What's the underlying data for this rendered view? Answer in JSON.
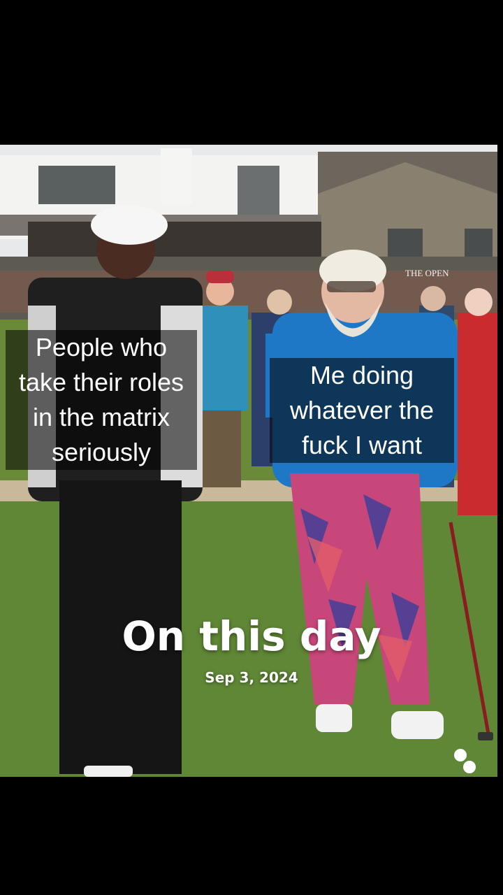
{
  "meme": {
    "caption_left": [
      "People who",
      "take their roles",
      "in the matrix",
      "seriously"
    ],
    "caption_right": [
      "Me doing",
      "whatever the",
      "fuck I want"
    ]
  },
  "memory": {
    "title": "On this day",
    "date": "Sep 3, 2024"
  },
  "scene": {
    "sign_text": "THE OPEN"
  }
}
